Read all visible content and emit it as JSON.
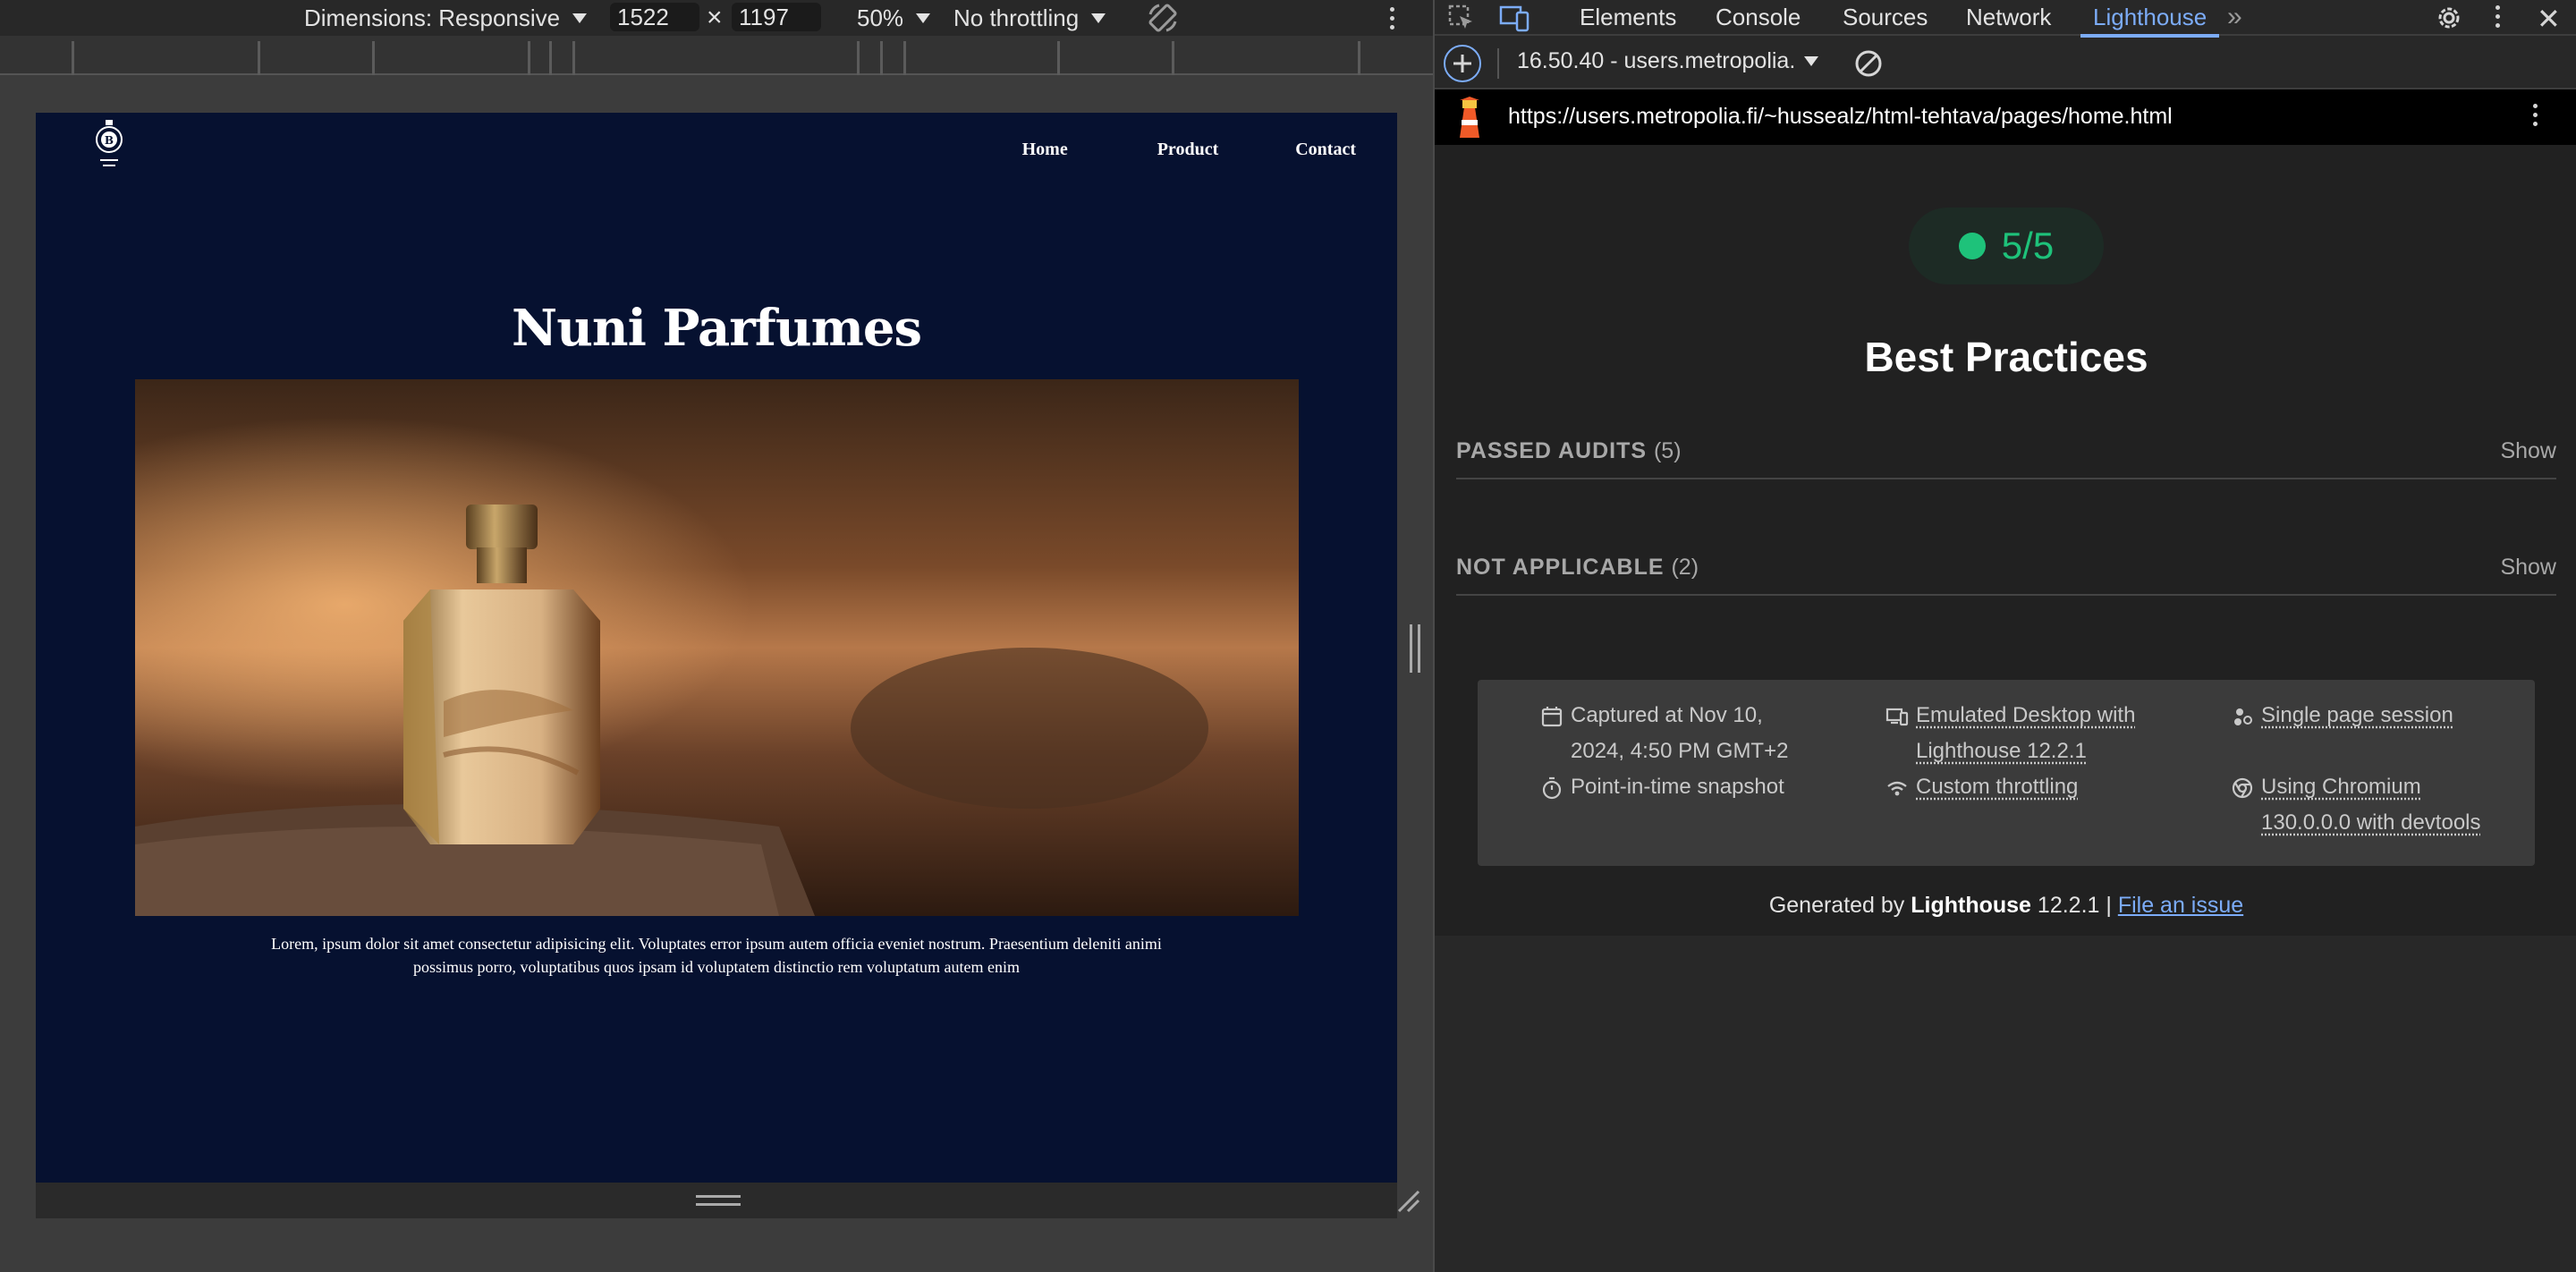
{
  "device_toolbar": {
    "dimensions_label": "Dimensions: Responsive",
    "width": "1522",
    "times": "×",
    "height": "1197",
    "zoom": "50%",
    "throttling": "No throttling"
  },
  "site": {
    "nav": [
      "Home",
      "Product",
      "Contact"
    ],
    "title": "Nuni Parfumes",
    "caption": "Lorem, ipsum dolor sit amet consectetur adipisicing elit. Voluptates error ipsum autem officia eveniet nostrum. Praesentium deleniti animi possimus porro, voluptatibus quos ipsam id voluptatem distinctio rem voluptatum autem enim",
    "background": "#061130"
  },
  "devtools": {
    "tabs": [
      "Elements",
      "Console",
      "Sources",
      "Network",
      "Lighthouse"
    ],
    "active_tab": "Lighthouse",
    "report_selector": "16.50.40 - users.metropolia.",
    "url": "https://users.metropolia.fi/~hussealz/html-tehtava/pages/home.html",
    "accent": "#7cacf8"
  },
  "lighthouse": {
    "score": "5/5",
    "score_color": "#1ec27a",
    "category": "Best Practices",
    "groups": [
      {
        "label": "PASSED AUDITS",
        "count": "(5)",
        "action": "Show"
      },
      {
        "label": "NOT APPLICABLE",
        "count": "(2)",
        "action": "Show"
      }
    ],
    "env": {
      "captured_line1": "Captured at Nov 10,",
      "captured_line2": "2024, 4:50 PM GMT+2",
      "snapshot": "Point-in-time snapshot",
      "emulated_line1": "Emulated Desktop with",
      "emulated_line2": "Lighthouse 12.2.1",
      "throttling": "Custom throttling",
      "session": "Single page session",
      "chromium_line1": "Using Chromium",
      "chromium_line2": "130.0.0.0 with devtools"
    },
    "footer": {
      "prefix": "Generated by ",
      "brand": "Lighthouse",
      "version": " 12.2.1 | ",
      "link": "File an issue"
    }
  }
}
